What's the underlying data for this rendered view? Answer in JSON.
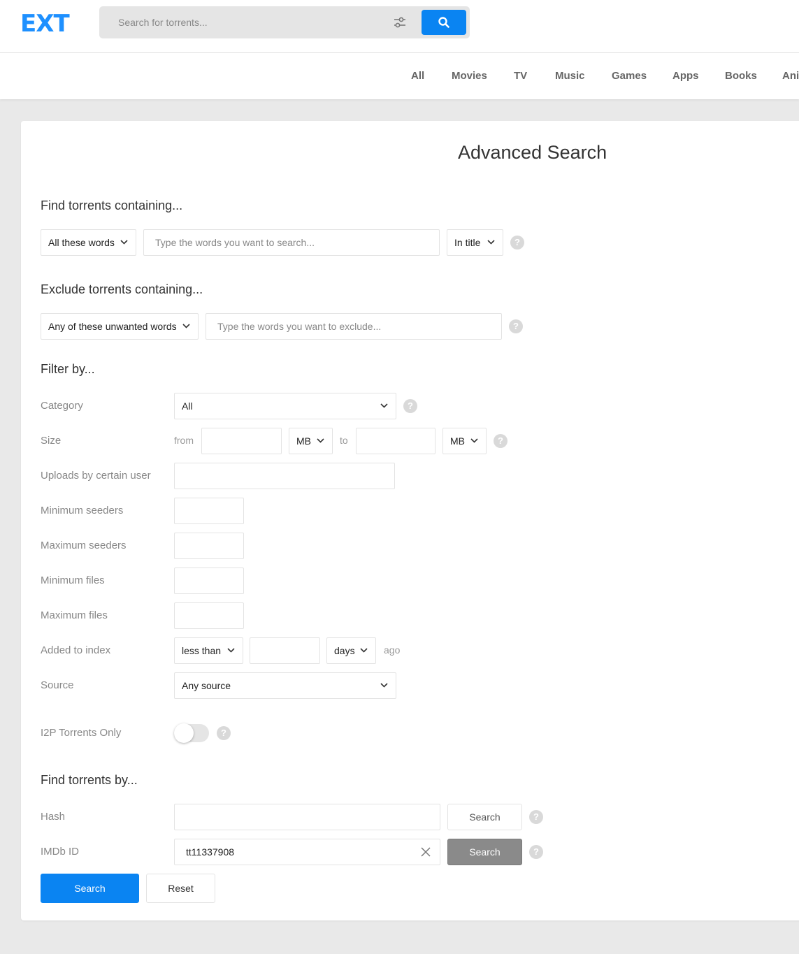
{
  "header": {
    "logo": "EXT",
    "search_placeholder": "Search for torrents..."
  },
  "nav": [
    "All",
    "Movies",
    "TV",
    "Music",
    "Games",
    "Apps",
    "Books",
    "Anime"
  ],
  "page_title": "Advanced Search",
  "find": {
    "title": "Find torrents containing...",
    "mode": "All these words",
    "placeholder": "Type the words you want to search...",
    "scope": "In title"
  },
  "exclude": {
    "title": "Exclude torrents containing...",
    "mode": "Any of these unwanted words",
    "placeholder": "Type the words you want to exclude..."
  },
  "filter": {
    "title": "Filter by...",
    "category_label": "Category",
    "category_value": "All",
    "size_label": "Size",
    "size_from": "from",
    "size_unit_from": "MB",
    "size_to": "to",
    "size_unit_to": "MB",
    "uploader_label": "Uploads by certain user",
    "min_seeders_label": "Minimum seeders",
    "max_seeders_label": "Maximum seeders",
    "min_files_label": "Minimum files",
    "max_files_label": "Maximum files",
    "added_label": "Added to index",
    "added_comparator": "less than",
    "added_unit": "days",
    "added_suffix": "ago",
    "source_label": "Source",
    "source_value": "Any source",
    "i2p_label": "I2P Torrents Only",
    "i2p_enabled": false
  },
  "find_by": {
    "title": "Find torrents by...",
    "hash_label": "Hash",
    "hash_value": "",
    "hash_button": "Search",
    "imdb_label": "IMDb ID",
    "imdb_value": "tt11337908",
    "imdb_button": "Search"
  },
  "actions": {
    "search": "Search",
    "reset": "Reset"
  },
  "help_glyph": "?",
  "colors": {
    "accent": "#0a84f2",
    "disabled_button": "#8a8a8a"
  }
}
